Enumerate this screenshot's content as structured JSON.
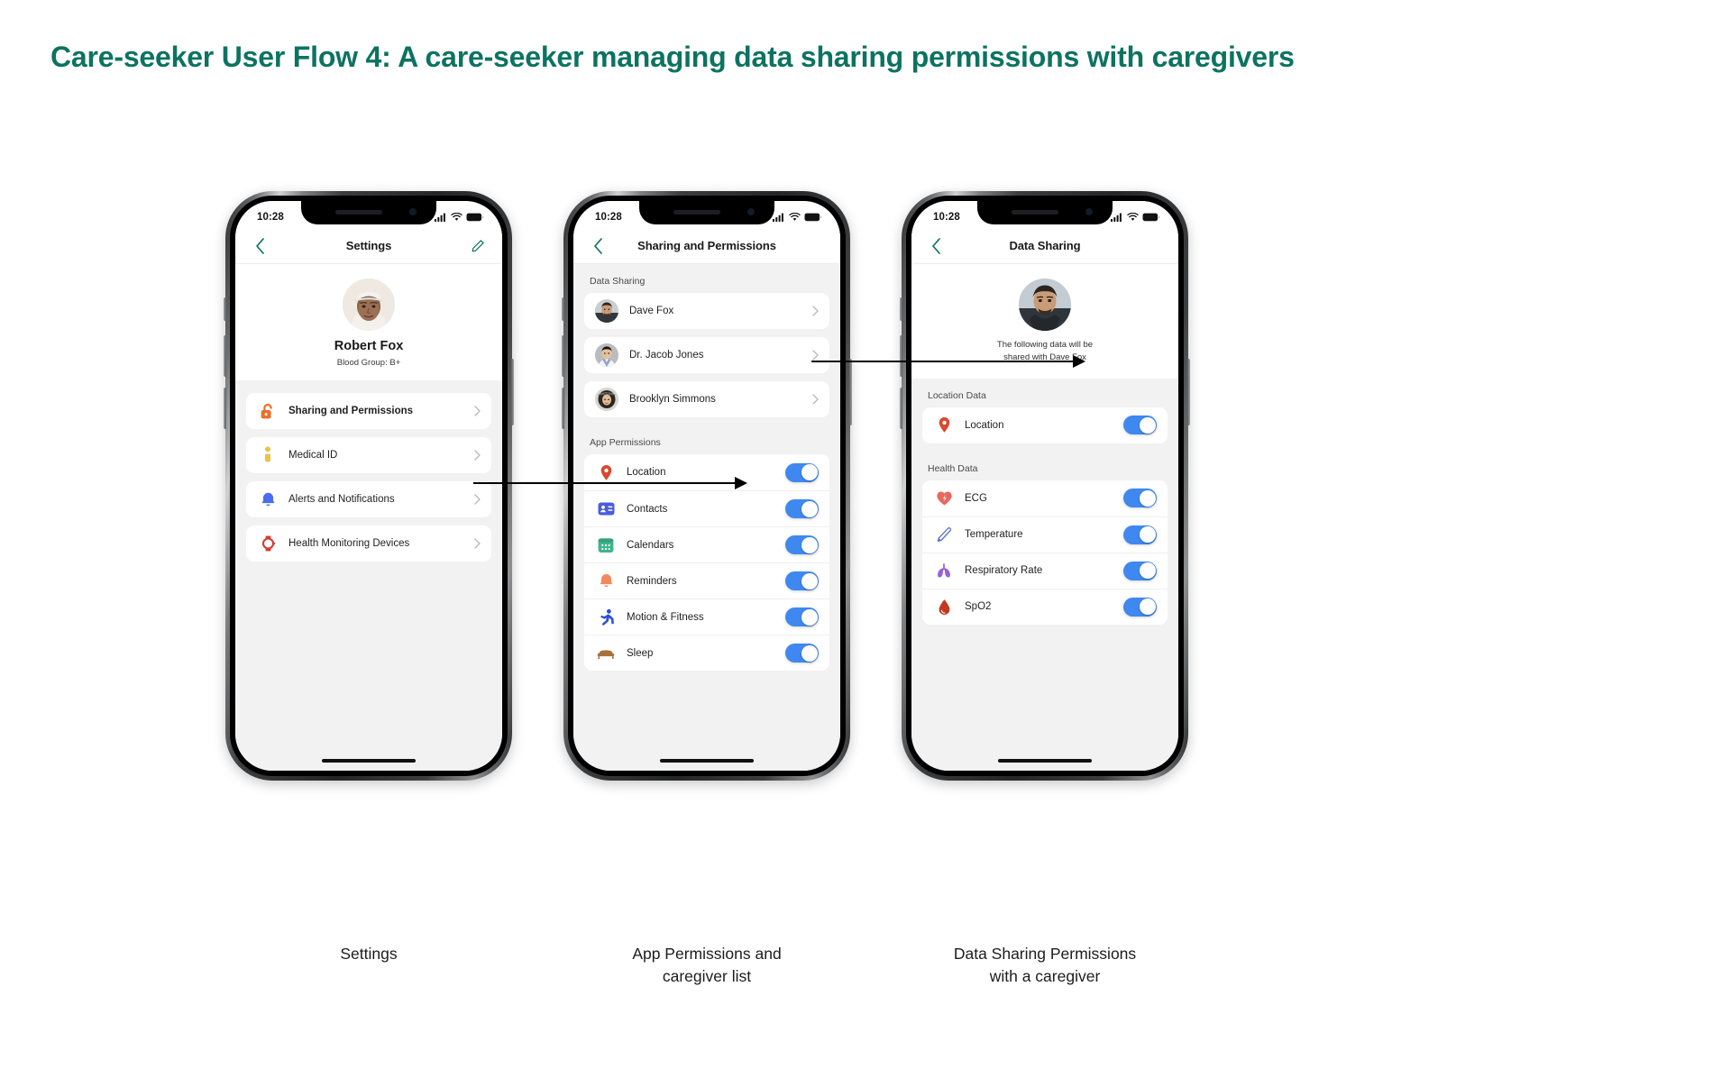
{
  "title": "Care-seeker User Flow 4: A care-seeker managing data sharing permissions with caregivers",
  "colors": {
    "title": "#0d7361",
    "accent_teal": "#0d7361",
    "toggle_on": "#3f88f0",
    "screen_bg": "#f2f2f2",
    "card_bg": "#ffffff"
  },
  "phones": [
    {
      "id": "settings",
      "status": {
        "time": "10:28",
        "signal": "cellular-bars-icon",
        "wifi": "wifi-icon",
        "battery": "battery-icon"
      },
      "nav": {
        "back": "chevron-left-icon",
        "title": "Settings",
        "action": "pencil-edit-icon"
      },
      "profile": {
        "avatar": "avatar-robert-fox",
        "name": "Robert Fox",
        "subtitle": "Blood Group: B+"
      },
      "items": [
        {
          "label": "Sharing and Permissions",
          "icon": "unlock-icon",
          "icon_color": "#e8702a",
          "chevron": "chevron-right-icon",
          "bold": true
        },
        {
          "label": "Medical ID",
          "icon": "person-medical-id-icon",
          "icon_color": "#e9c44c",
          "chevron": "chevron-right-icon",
          "bold": false
        },
        {
          "label": "Alerts and Notifications",
          "icon": "bell-icon",
          "icon_color": "#4a6cf0",
          "chevron": "chevron-right-icon",
          "bold": false
        },
        {
          "label": "Health Monitoring Devices",
          "icon": "smartwatch-icon",
          "icon_color": "#d03d33",
          "chevron": "chevron-right-icon",
          "bold": false
        }
      ],
      "caption": "Settings"
    },
    {
      "id": "sharing-permissions",
      "status": {
        "time": "10:28",
        "signal": "cellular-bars-icon",
        "wifi": "wifi-icon",
        "battery": "battery-icon"
      },
      "nav": {
        "back": "chevron-left-icon",
        "title": "Sharing and Permissions",
        "action": ""
      },
      "sections": [
        {
          "label": "Data Sharing",
          "type": "people",
          "items": [
            {
              "label": "Dave Fox",
              "avatar": "avatar-dave-fox",
              "chevron": "chevron-right-icon"
            },
            {
              "label": "Dr. Jacob Jones",
              "avatar": "avatar-jacob-jones",
              "chevron": "chevron-right-icon"
            },
            {
              "label": "Brooklyn Simmons",
              "avatar": "avatar-brooklyn-simmons",
              "chevron": "chevron-right-icon"
            }
          ]
        },
        {
          "label": "App Permissions",
          "type": "toggles",
          "items": [
            {
              "label": "Location",
              "icon": "location-pin-icon",
              "icon_color": "#d9482f",
              "enabled": true
            },
            {
              "label": "Contacts",
              "icon": "contacts-card-icon",
              "icon_color": "#4a5ddb",
              "enabled": true
            },
            {
              "label": "Calendars",
              "icon": "calendar-icon",
              "icon_color": "#3eb489",
              "enabled": true
            },
            {
              "label": "Reminders",
              "icon": "bell-reminder-icon",
              "icon_color": "#f08a5d",
              "enabled": true
            },
            {
              "label": "Motion & Fitness",
              "icon": "running-person-icon",
              "icon_color": "#2a4fd6",
              "enabled": true
            },
            {
              "label": "Sleep",
              "icon": "bed-icon",
              "icon_color": "#a8713a",
              "enabled": true
            }
          ]
        }
      ],
      "caption": "App Permissions and\ncaregiver list",
      "caption_line1": "App Permissions and",
      "caption_line2": "caregiver list"
    },
    {
      "id": "data-sharing",
      "status": {
        "time": "10:28",
        "signal": "cellular-bars-icon",
        "wifi": "wifi-icon",
        "battery": "battery-icon"
      },
      "nav": {
        "back": "chevron-left-icon",
        "title": "Data Sharing",
        "action": ""
      },
      "header": {
        "avatar": "avatar-dave-fox",
        "description_line1": "The following data will be",
        "description_line2": "shared with Dave Fox"
      },
      "sections": [
        {
          "label": "Location Data",
          "items": [
            {
              "label": "Location",
              "icon": "location-pin-icon",
              "icon_color": "#d9482f",
              "enabled": true
            }
          ]
        },
        {
          "label": "Health Data",
          "items": [
            {
              "label": "ECG",
              "icon": "heart-ecg-icon",
              "icon_color": "#e8685f",
              "enabled": true
            },
            {
              "label": "Temperature",
              "icon": "thermometer-icon",
              "icon_color": "#5b6fc9",
              "enabled": true
            },
            {
              "label": "Respiratory Rate",
              "icon": "lungs-icon",
              "icon_color": "#9a5fd6",
              "enabled": true
            },
            {
              "label": "SpO2",
              "icon": "blood-drop-icon",
              "icon_color": "#c03a21",
              "enabled": true
            }
          ]
        }
      ],
      "caption_line1": "Data Sharing Permissions",
      "caption_line2": "with a caregiver"
    }
  ]
}
